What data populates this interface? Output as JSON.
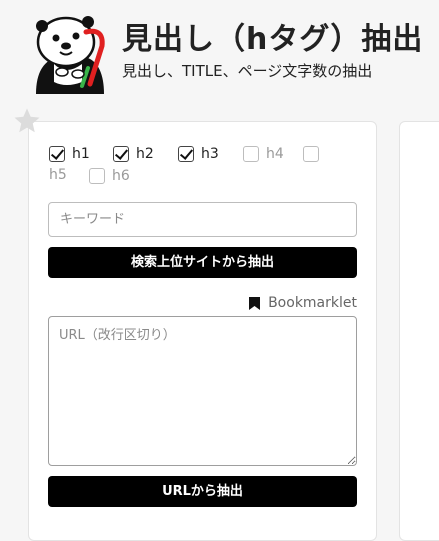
{
  "header": {
    "title": "見出し（hタグ）抽出",
    "subtitle": "見出し、TITLE、ページ文字数の抽出"
  },
  "headings": [
    {
      "label": "h1",
      "checked": true
    },
    {
      "label": "h2",
      "checked": true
    },
    {
      "label": "h3",
      "checked": true
    },
    {
      "label": "h4",
      "checked": false
    },
    {
      "label": "h5",
      "checked": false
    },
    {
      "label": "h6",
      "checked": false
    }
  ],
  "keyword": {
    "placeholder": "キーワード",
    "value": ""
  },
  "search_button": "検索上位サイトから抽出",
  "bookmarklet_label": "Bookmarklet",
  "url_input": {
    "placeholder": "URL（改行区切り）",
    "value": ""
  },
  "url_button": "URLから抽出",
  "colors": {
    "primary": "#000000",
    "background": "#f6f6f6",
    "star": "#dcdcdc"
  },
  "icons": [
    "mascot-otter-icon",
    "star-icon",
    "bookmark-icon"
  ]
}
